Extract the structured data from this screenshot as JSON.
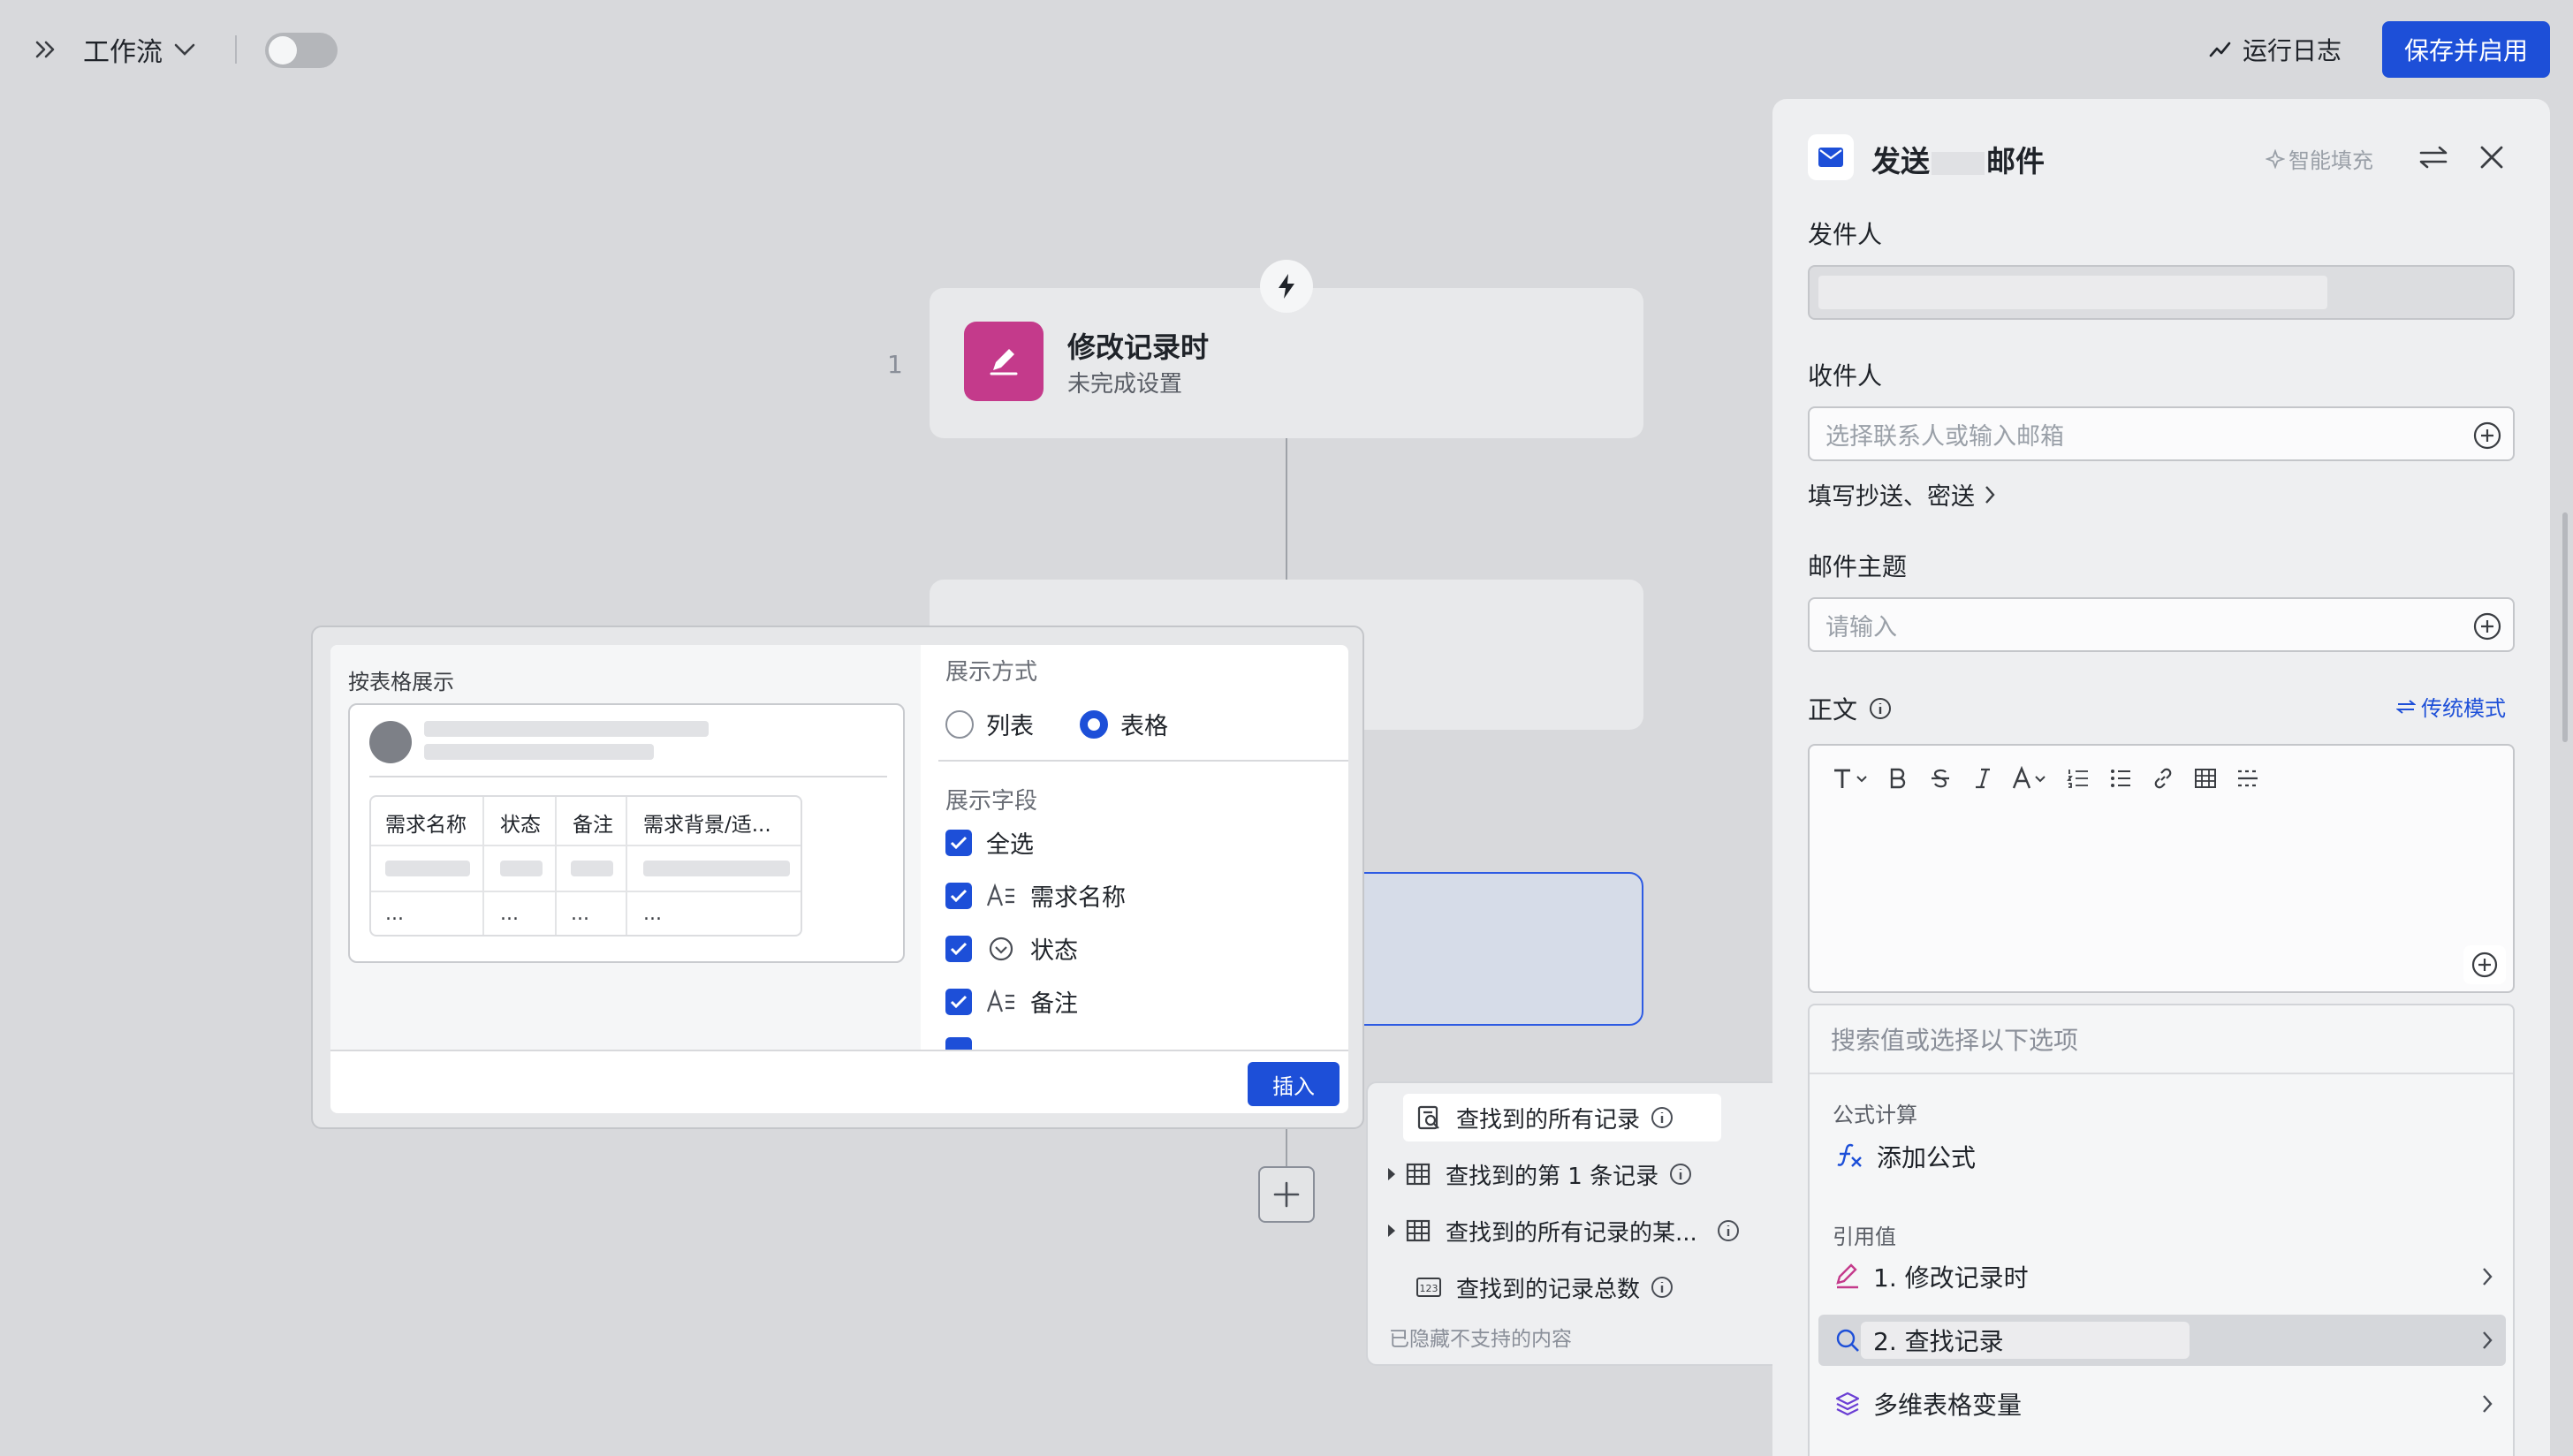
{
  "topbar": {
    "title": "工作流",
    "log_label": "运行日志",
    "save_label": "保存并启用"
  },
  "canvas": {
    "step_number": "1",
    "node1": {
      "title": "修改记录时",
      "subtitle": "未完成设置"
    }
  },
  "display_popup": {
    "left_title": "按表格展示",
    "preview_headers": [
      "需求名称",
      "状态",
      "备注",
      "需求背景/适..."
    ],
    "preview_ellipsis": "...",
    "mode_label": "展示方式",
    "mode_options": [
      "列表",
      "表格"
    ],
    "mode_selected": "表格",
    "fields_label": "展示字段",
    "select_all": "全选",
    "fields": [
      "需求名称",
      "状态",
      "备注"
    ],
    "insert_label": "插入"
  },
  "submenu": {
    "items": [
      "查找到的所有记录",
      "查找到的第 1 条记录",
      "查找到的所有记录的某...",
      "查找到的记录总数"
    ],
    "footer": "已隐藏不支持的内容"
  },
  "panel": {
    "title_left": "发送",
    "title_right": "邮件",
    "smart_fill": "智能填充",
    "sender_label": "发件人",
    "recipient_label": "收件人",
    "recipient_placeholder": "选择联系人或输入邮箱",
    "cc_link": "填写抄送、密送",
    "subject_label": "邮件主题",
    "subject_placeholder": "请输入",
    "body_label": "正文",
    "legacy_mode": "传统模式",
    "value_list": {
      "search_placeholder": "搜索值或选择以下选项",
      "section_formula": "公式计算",
      "add_formula": "添加公式",
      "section_ref": "引用值",
      "ref_items": [
        "1. 修改记录时",
        "2. 查找记录",
        "多维表格变量"
      ]
    }
  },
  "colors": {
    "accent": "#1d4fd8",
    "node_icon": "#c43a8b",
    "mail_icon": "#1d4fd8"
  }
}
